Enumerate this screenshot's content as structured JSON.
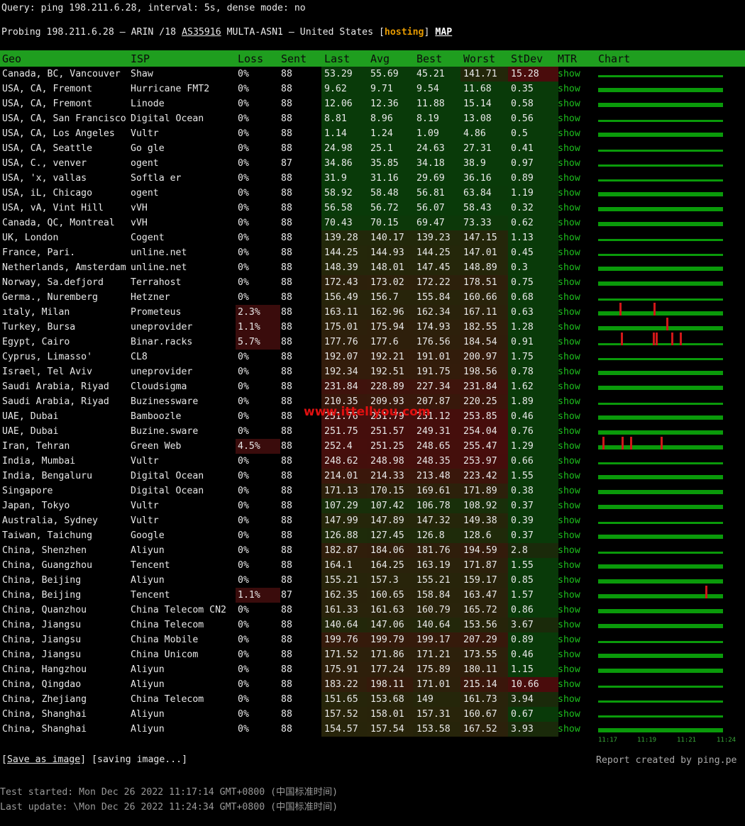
{
  "header": {
    "query": "Query: ping 198.211.6.28, interval: 5s, dense mode: no",
    "probe_prefix": "Probing 198.211.6.28 — ARIN /18 ",
    "asn": "AS35916",
    "probe_mid": " MULTA-ASN1 — United States [",
    "hosting": "hosting",
    "probe_close": "] ",
    "map": "MAP"
  },
  "columns": [
    "Geo",
    "ISP",
    "Loss",
    "Sent",
    "Last",
    "Avg",
    "Best",
    "Worst",
    "StDev",
    "MTR",
    "Chart"
  ],
  "colors": {
    "header_bg": "#1f9e1f",
    "show_link": "#1dbf1d",
    "chart_bar": "#0a9a0a",
    "loss_spike": "#d01818",
    "hosting": "#e69a00"
  },
  "rows": [
    {
      "geo": "Canada, BC, Vancouver",
      "isp": "Shaw",
      "loss": "0%",
      "sent": "88",
      "last": "53.29",
      "avg": "55.69",
      "best": "45.21",
      "worst": "141.71",
      "stdev": "15.28",
      "mtr": "show"
    },
    {
      "geo": "USA, CA, Fremont",
      "isp": "Hurricane FMT2",
      "loss": "0%",
      "sent": "88",
      "last": "9.62",
      "avg": "9.71",
      "best": "9.54",
      "worst": "11.68",
      "stdev": "0.35",
      "mtr": "show"
    },
    {
      "geo": "USA, CA, Fremont",
      "isp": "Linode",
      "loss": "0%",
      "sent": "88",
      "last": "12.06",
      "avg": "12.36",
      "best": "11.88",
      "worst": "15.14",
      "stdev": "0.58",
      "mtr": "show"
    },
    {
      "geo": "USA, CA, San Francisco",
      "isp": "Digital Ocean",
      "loss": "0%",
      "sent": "88",
      "last": "8.81",
      "avg": "8.96",
      "best": "8.19",
      "worst": "13.08",
      "stdev": "0.56",
      "mtr": "show"
    },
    {
      "geo": "USA, CA, Los Angeles",
      "isp": "Vultr",
      "loss": "0%",
      "sent": "88",
      "last": "1.14",
      "avg": "1.24",
      "best": "1.09",
      "worst": "4.86",
      "stdev": "0.5",
      "mtr": "show"
    },
    {
      "geo": "USA, CA, Seattle",
      "isp": "Go gle",
      "loss": "0%",
      "sent": "88",
      "last": "24.98",
      "avg": "25.1",
      "best": "24.63",
      "worst": "27.31",
      "stdev": "0.41",
      "mtr": "show"
    },
    {
      "geo": "USA, C., venver",
      "isp": "ogent",
      "loss": "0%",
      "sent": "87",
      "last": "34.86",
      "avg": "35.85",
      "best": "34.18",
      "worst": "38.9",
      "stdev": "0.97",
      "mtr": "show"
    },
    {
      "geo": "USA, 'x, vallas",
      "isp": "Softla er",
      "loss": "0%",
      "sent": "88",
      "last": "31.9",
      "avg": "31.16",
      "best": "29.69",
      "worst": "36.16",
      "stdev": "0.89",
      "mtr": "show"
    },
    {
      "geo": "USA, iL, Chicago",
      "isp": "ogent",
      "loss": "0%",
      "sent": "88",
      "last": "58.92",
      "avg": "58.48",
      "best": "56.81",
      "worst": "63.84",
      "stdev": "1.19",
      "mtr": "show"
    },
    {
      "geo": "USA, vA, Vint Hill",
      "isp": "vVH",
      "loss": "0%",
      "sent": "88",
      "last": "56.58",
      "avg": "56.72",
      "best": "56.07",
      "worst": "58.43",
      "stdev": "0.32",
      "mtr": "show"
    },
    {
      "geo": "Canada, QC, Montreal",
      "isp": "vVH",
      "loss": "0%",
      "sent": "88",
      "last": "70.43",
      "avg": "70.15",
      "best": "69.47",
      "worst": "73.33",
      "stdev": "0.62",
      "mtr": "show"
    },
    {
      "geo": "UK, London",
      "isp": "Cogent",
      "loss": "0%",
      "sent": "88",
      "last": "139.28",
      "avg": "140.17",
      "best": "139.23",
      "worst": "147.15",
      "stdev": "1.13",
      "mtr": "show"
    },
    {
      "geo": "France, Pari.",
      "isp": "unline.net",
      "loss": "0%",
      "sent": "88",
      "last": "144.25",
      "avg": "144.93",
      "best": "144.25",
      "worst": "147.01",
      "stdev": "0.45",
      "mtr": "show"
    },
    {
      "geo": "Netherlands, Amsterdam",
      "isp": "unline.net",
      "loss": "0%",
      "sent": "88",
      "last": "148.39",
      "avg": "148.01",
      "best": "147.45",
      "worst": "148.89",
      "stdev": "0.3",
      "mtr": "show"
    },
    {
      "geo": "Norway, Sa.defjord",
      "isp": "Terrahost",
      "loss": "0%",
      "sent": "88",
      "last": "172.43",
      "avg": "173.02",
      "best": "172.22",
      "worst": "178.51",
      "stdev": "0.75",
      "mtr": "show"
    },
    {
      "geo": "Germa., Nuremberg",
      "isp": "Hetzner",
      "loss": "0%",
      "sent": "88",
      "last": "156.49",
      "avg": "156.7",
      "best": "155.84",
      "worst": "160.66",
      "stdev": "0.68",
      "mtr": "show"
    },
    {
      "geo": "ıtaly, Milan",
      "isp": "Prometeus",
      "loss": "2.3%",
      "sent": "88",
      "last": "163.11",
      "avg": "162.96",
      "best": "162.34",
      "worst": "167.11",
      "stdev": "0.63",
      "mtr": "show"
    },
    {
      "geo": "Turkey, Bursa",
      "isp": "uneprovider",
      "loss": "1.1%",
      "sent": "88",
      "last": "175.01",
      "avg": "175.94",
      "best": "174.93",
      "worst": "182.55",
      "stdev": "1.28",
      "mtr": "show"
    },
    {
      "geo": "Egypt, Cairo",
      "isp": "Binar.racks",
      "loss": "5.7%",
      "sent": "88",
      "last": "177.76",
      "avg": "177.6",
      "best": "176.56",
      "worst": "184.54",
      "stdev": "0.91",
      "mtr": "show"
    },
    {
      "geo": "Cyprus, Limasso'",
      "isp": "CL8",
      "loss": "0%",
      "sent": "88",
      "last": "192.07",
      "avg": "192.21",
      "best": "191.01",
      "worst": "200.97",
      "stdev": "1.75",
      "mtr": "show"
    },
    {
      "geo": "Israel, Tel Aviv",
      "isp": "uneprovider",
      "loss": "0%",
      "sent": "88",
      "last": "192.34",
      "avg": "192.51",
      "best": "191.75",
      "worst": "198.56",
      "stdev": "0.78",
      "mtr": "show"
    },
    {
      "geo": "Saudi Arabia, Riyad",
      "isp": "Cloudsigma",
      "loss": "0%",
      "sent": "88",
      "last": "231.84",
      "avg": "228.89",
      "best": "227.34",
      "worst": "231.84",
      "stdev": "1.62",
      "mtr": "show"
    },
    {
      "geo": "Saudi Arabia, Riyad",
      "isp": "Buzinessware",
      "loss": "0%",
      "sent": "88",
      "last": "210.35",
      "avg": "209.93",
      "best": "207.87",
      "worst": "220.25",
      "stdev": "1.89",
      "mtr": "show"
    },
    {
      "geo": "UAE, Dubai",
      "isp": "Bamboozle",
      "loss": "0%",
      "sent": "88",
      "last": "251.76",
      "avg": "251.79",
      "best": "251.12",
      "worst": "253.85",
      "stdev": "0.46",
      "mtr": "show"
    },
    {
      "geo": "UAE, Dubai",
      "isp": "Buzine.sware",
      "loss": "0%",
      "sent": "88",
      "last": "251.75",
      "avg": "251.57",
      "best": "249.31",
      "worst": "254.04",
      "stdev": "0.76",
      "mtr": "show"
    },
    {
      "geo": "Iran, Tehran",
      "isp": "Green Web",
      "loss": "4.5%",
      "sent": "88",
      "last": "252.4",
      "avg": "251.25",
      "best": "248.65",
      "worst": "255.47",
      "stdev": "1.29",
      "mtr": "show"
    },
    {
      "geo": "India, Mumbai",
      "isp": "Vultr",
      "loss": "0%",
      "sent": "88",
      "last": "248.62",
      "avg": "248.98",
      "best": "248.35",
      "worst": "253.97",
      "stdev": "0.66",
      "mtr": "show"
    },
    {
      "geo": "India, Bengaluru",
      "isp": "Digital Ocean",
      "loss": "0%",
      "sent": "88",
      "last": "214.01",
      "avg": "214.33",
      "best": "213.48",
      "worst": "223.42",
      "stdev": "1.55",
      "mtr": "show"
    },
    {
      "geo": "Singapore",
      "isp": "Digital Ocean",
      "loss": "0%",
      "sent": "88",
      "last": "171.13",
      "avg": "170.15",
      "best": "169.61",
      "worst": "171.89",
      "stdev": "0.38",
      "mtr": "show"
    },
    {
      "geo": "Japan, Tokyo",
      "isp": "Vultr",
      "loss": "0%",
      "sent": "88",
      "last": "107.29",
      "avg": "107.42",
      "best": "106.78",
      "worst": "108.92",
      "stdev": "0.37",
      "mtr": "show"
    },
    {
      "geo": "Australia, Sydney",
      "isp": "Vultr",
      "loss": "0%",
      "sent": "88",
      "last": "147.99",
      "avg": "147.89",
      "best": "147.32",
      "worst": "149.38",
      "stdev": "0.39",
      "mtr": "show"
    },
    {
      "geo": "Taiwan, Taichung",
      "isp": "Google",
      "loss": "0%",
      "sent": "88",
      "last": "126.88",
      "avg": "127.45",
      "best": "126.8",
      "worst": "128.6",
      "stdev": "0.37",
      "mtr": "show"
    },
    {
      "geo": "China, Shenzhen",
      "isp": "Aliyun",
      "loss": "0%",
      "sent": "88",
      "last": "182.87",
      "avg": "184.06",
      "best": "181.76",
      "worst": "194.59",
      "stdev": "2.8",
      "mtr": "show"
    },
    {
      "geo": "China, Guangzhou",
      "isp": "Tencent",
      "loss": "0%",
      "sent": "88",
      "last": "164.1",
      "avg": "164.25",
      "best": "163.19",
      "worst": "171.87",
      "stdev": "1.55",
      "mtr": "show"
    },
    {
      "geo": "China, Beijing",
      "isp": "Aliyun",
      "loss": "0%",
      "sent": "88",
      "last": "155.21",
      "avg": "157.3",
      "best": "155.21",
      "worst": "159.17",
      "stdev": "0.85",
      "mtr": "show"
    },
    {
      "geo": "China, Beijing",
      "isp": "Tencent",
      "loss": "1.1%",
      "sent": "87",
      "last": "162.35",
      "avg": "160.65",
      "best": "158.84",
      "worst": "163.47",
      "stdev": "1.57",
      "mtr": "show"
    },
    {
      "geo": "China, Quanzhou",
      "isp": "China Telecom CN2",
      "loss": "0%",
      "sent": "88",
      "last": "161.33",
      "avg": "161.63",
      "best": "160.79",
      "worst": "165.72",
      "stdev": "0.86",
      "mtr": "show"
    },
    {
      "geo": "China, Jiangsu",
      "isp": "China Telecom",
      "loss": "0%",
      "sent": "88",
      "last": "140.64",
      "avg": "147.06",
      "best": "140.64",
      "worst": "153.56",
      "stdev": "3.67",
      "mtr": "show"
    },
    {
      "geo": "China, Jiangsu",
      "isp": "China Mobile",
      "loss": "0%",
      "sent": "88",
      "last": "199.76",
      "avg": "199.79",
      "best": "199.17",
      "worst": "207.29",
      "stdev": "0.89",
      "mtr": "show"
    },
    {
      "geo": "China, Jiangsu",
      "isp": "China Unicom",
      "loss": "0%",
      "sent": "88",
      "last": "171.52",
      "avg": "171.86",
      "best": "171.21",
      "worst": "173.55",
      "stdev": "0.46",
      "mtr": "show"
    },
    {
      "geo": "China, Hangzhou",
      "isp": "Aliyun",
      "loss": "0%",
      "sent": "88",
      "last": "175.91",
      "avg": "177.24",
      "best": "175.89",
      "worst": "180.11",
      "stdev": "1.15",
      "mtr": "show"
    },
    {
      "geo": "China, Qingdao",
      "isp": "Aliyun",
      "loss": "0%",
      "sent": "88",
      "last": "183.22",
      "avg": "198.11",
      "best": "171.01",
      "worst": "215.14",
      "stdev": "10.66",
      "mtr": "show"
    },
    {
      "geo": "China, Zhejiang",
      "isp": "China Telecom",
      "loss": "0%",
      "sent": "88",
      "last": "151.65",
      "avg": "153.68",
      "best": "149",
      "worst": "161.73",
      "stdev": "3.94",
      "mtr": "show"
    },
    {
      "geo": "China, Shanghai",
      "isp": "Aliyun",
      "loss": "0%",
      "sent": "88",
      "last": "157.52",
      "avg": "158.01",
      "best": "157.31",
      "worst": "160.67",
      "stdev": "0.67",
      "mtr": "show"
    },
    {
      "geo": "China, Shanghai",
      "isp": "Aliyun",
      "loss": "0%",
      "sent": "88",
      "last": "154.57",
      "avg": "157.54",
      "best": "153.58",
      "worst": "167.52",
      "stdev": "3.93",
      "mtr": "show"
    }
  ],
  "chart_axis": [
    "11:17",
    "11:19",
    "11:21",
    "11:24"
  ],
  "footer": {
    "save_link": "Save as image",
    "saving": " [saving image...]",
    "report": "Report created by ping.pe",
    "started": "Test started: Mon Dec 26 2022 11:17:14 GMT+0800 (中国标准时间)",
    "updated": "Last update: \\Mon Dec 26 2022 11:24:34 GMT+0800 (中国标准时间)"
  },
  "watermark": "www.ittellyou.com"
}
